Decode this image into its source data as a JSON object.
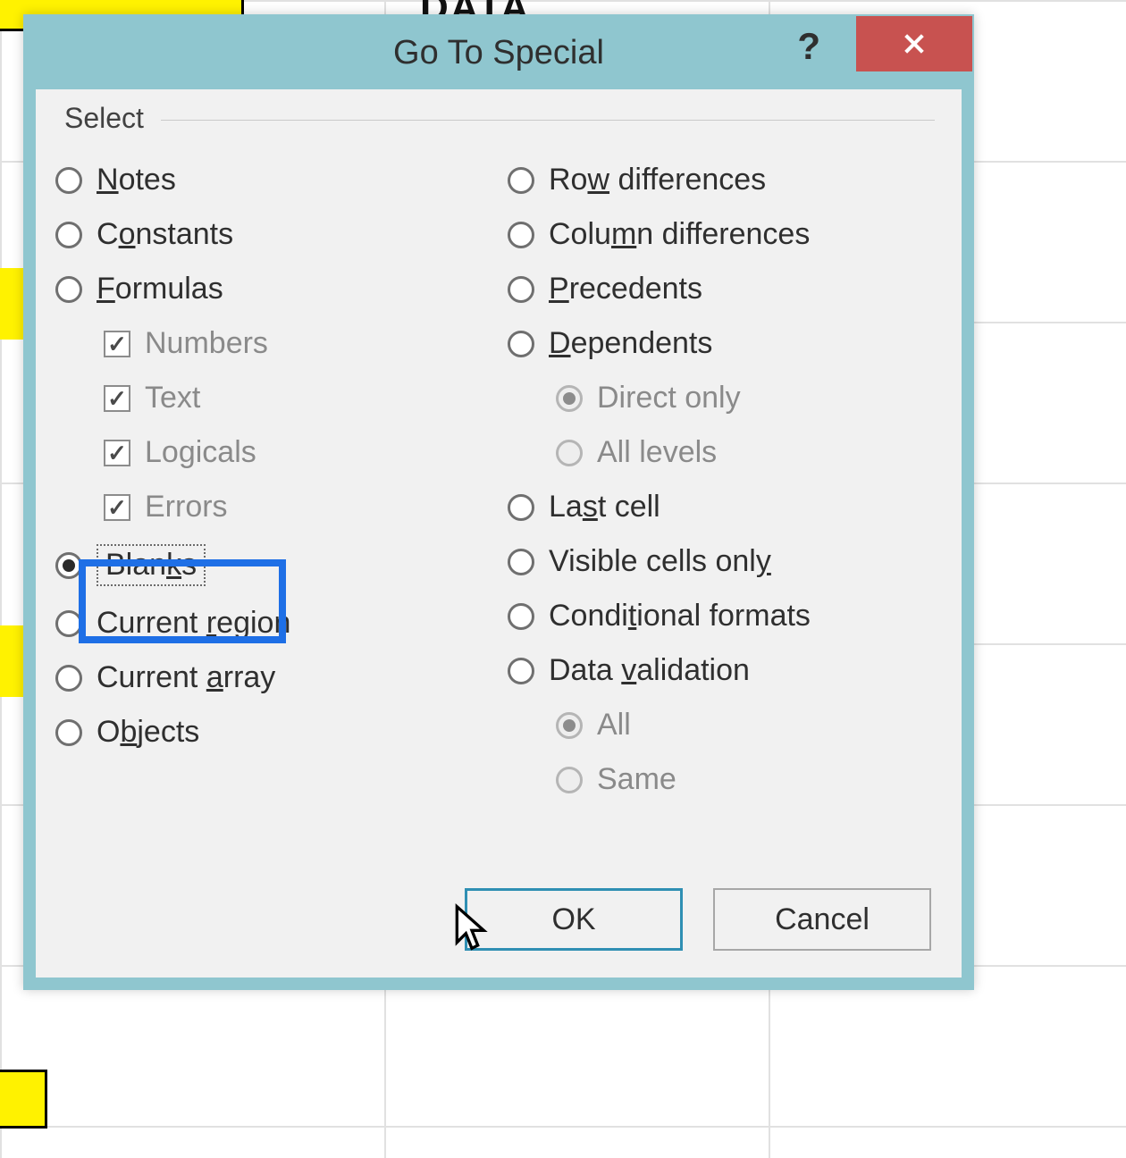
{
  "background": {
    "data_label": "DATA"
  },
  "dialog": {
    "title": "Go To Special",
    "help": "?",
    "group_label": "Select",
    "left_options": {
      "notes": {
        "pre": "",
        "u": "N",
        "post": "otes"
      },
      "constants": {
        "pre": "C",
        "u": "o",
        "post": "nstants"
      },
      "formulas": {
        "pre": "",
        "u": "F",
        "post": "ormulas"
      },
      "chk_numbers": {
        "label": "Numbers"
      },
      "chk_text": {
        "label": "Text"
      },
      "chk_logicals": {
        "label": "Logicals"
      },
      "chk_errors": {
        "label": "Errors"
      },
      "blanks": {
        "pre": "Blan",
        "u": "k",
        "post": "s"
      },
      "current_region": {
        "pre": "Current ",
        "u": "r",
        "post": "egion"
      },
      "current_array": {
        "pre": "Current ",
        "u": "a",
        "post": "rray"
      },
      "objects": {
        "pre": "O",
        "u": "b",
        "post": "jects"
      }
    },
    "right_options": {
      "row_diff": {
        "pre": "Ro",
        "u": "w",
        "post": " differences"
      },
      "col_diff": {
        "pre": "Colu",
        "u": "m",
        "post": "n differences"
      },
      "precedents": {
        "pre": "",
        "u": "P",
        "post": "recedents"
      },
      "dependents": {
        "pre": "",
        "u": "D",
        "post": "ependents"
      },
      "direct_only": {
        "label": "Direct only"
      },
      "all_levels": {
        "label": "All levels"
      },
      "last_cell": {
        "pre": "La",
        "u": "s",
        "post": "t cell"
      },
      "visible": {
        "pre": "Visible cells onl",
        "u": "y",
        "post": ""
      },
      "cond_formats": {
        "pre": "Condi",
        "u": "t",
        "post": "ional formats"
      },
      "data_valid": {
        "pre": "Data ",
        "u": "v",
        "post": "alidation"
      },
      "dv_all": {
        "label": "All"
      },
      "dv_same": {
        "label": "Same"
      }
    },
    "buttons": {
      "ok": "OK",
      "cancel": "Cancel"
    }
  }
}
